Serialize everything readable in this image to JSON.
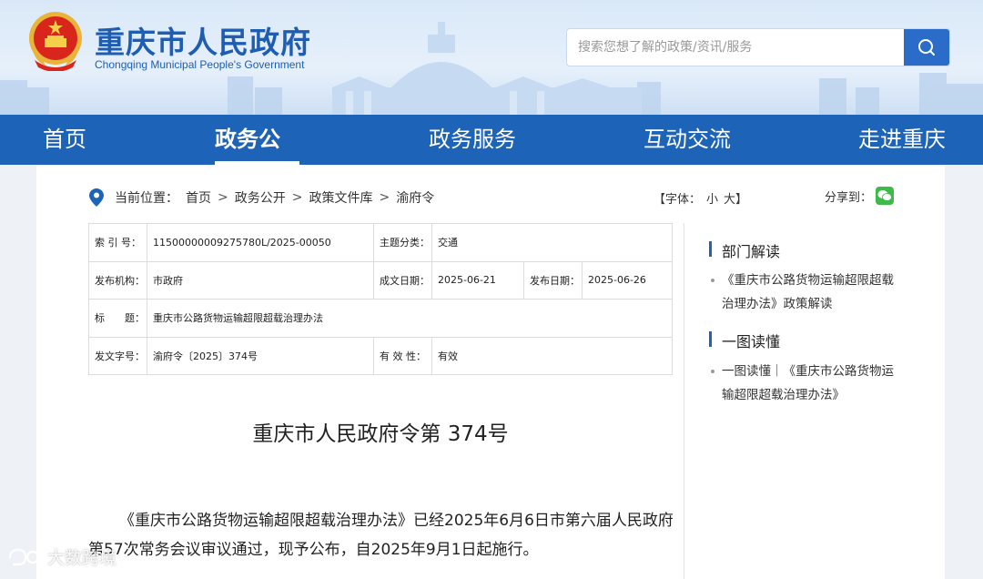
{
  "header": {
    "title": "重庆市人民政府",
    "subtitle": "Chongqing Municipal People's Government",
    "search_placeholder": "搜索您想了解的政策/资讯/服务",
    "accent": "#1d63b8"
  },
  "nav": {
    "items": [
      {
        "label": "首页"
      },
      {
        "label": "政务公开"
      },
      {
        "label": "政务服务"
      },
      {
        "label": "互动交流"
      },
      {
        "label": "走进重庆"
      }
    ],
    "active_index": 1
  },
  "breadcrumb": {
    "prefix": "当前位置：",
    "items": [
      "首页",
      "政务公开",
      "政策文件库",
      "渝府令"
    ],
    "separator": ">"
  },
  "font_control": {
    "label": "【字体：",
    "small": "小",
    "large": "大",
    "close": "】"
  },
  "share": {
    "label": "分享到："
  },
  "meta": {
    "index_no_label": "索 引 号：",
    "index_no": "11500000009275780L/2025-00050",
    "topic_label": "主题分类：",
    "topic": "交通",
    "issuer_label": "发布机构：",
    "issuer": "市政府",
    "made_date_label": "成文日期：",
    "made_date": "2025-06-21",
    "pub_date_label": "发布日期：",
    "pub_date": "2025-06-26",
    "title_label": "标　　题：",
    "title": "重庆市公路货物运输超限超载治理办法",
    "doc_no_label": "发文字号：",
    "doc_no": "渝府令〔2025〕374号",
    "validity_label": "有 效 性：",
    "validity": "有效"
  },
  "document": {
    "heading": "重庆市人民政府令第 374号",
    "paragraph": "《重庆市公路货物运输超限超载治理办法》已经2025年6月6日市第六届人民政府第57次常务会议审议通过，现予公布，自2025年9月1日起施行。"
  },
  "sidebar": {
    "section1_title": "部门解读",
    "section1_link": "《重庆市公路货物运输超限超载治理办法》政策解读",
    "section2_title": "一图读懂",
    "section2_link": "一图读懂｜《重庆市公路货物运输超限超载治理办法》"
  },
  "watermark": "大数跨境"
}
